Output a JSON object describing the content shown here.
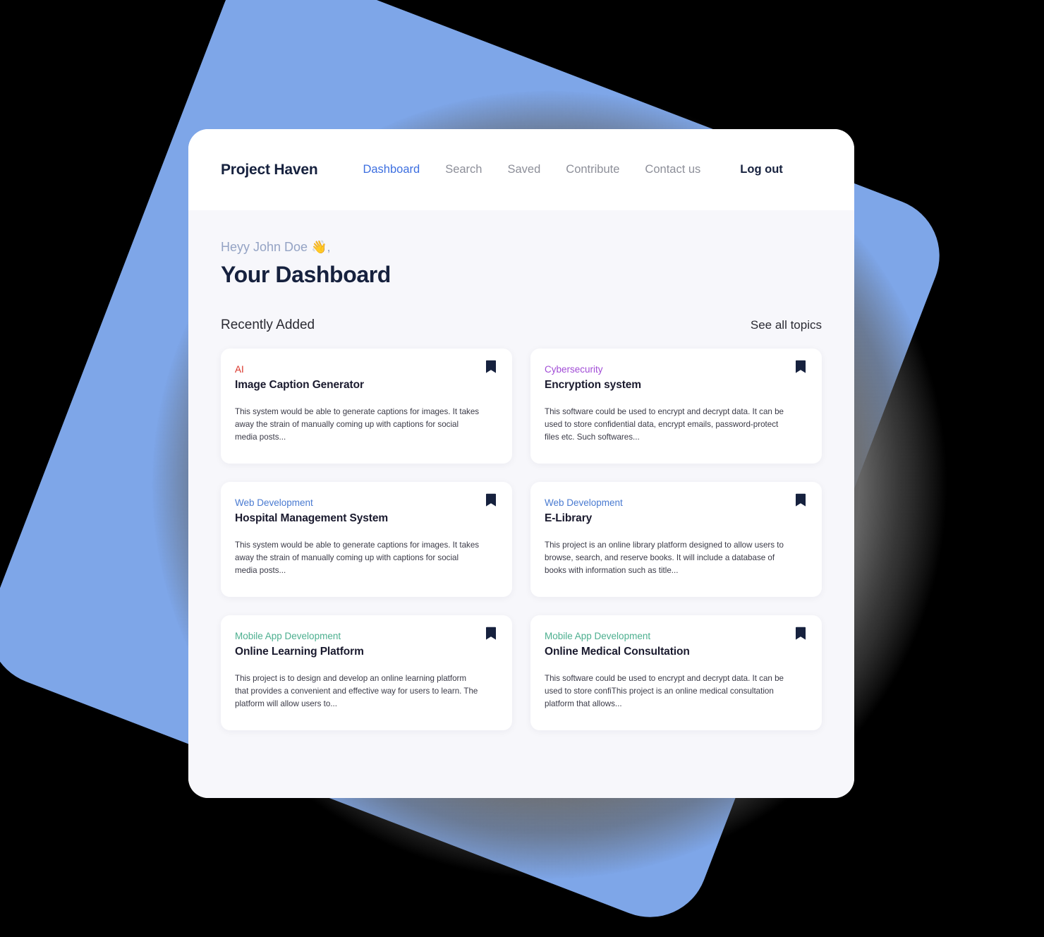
{
  "navbar": {
    "brand": "Project Haven",
    "links": [
      {
        "label": "Dashboard",
        "active": true
      },
      {
        "label": "Search",
        "active": false
      },
      {
        "label": "Saved",
        "active": false
      },
      {
        "label": "Contribute",
        "active": false
      },
      {
        "label": "Contact us",
        "active": false
      }
    ],
    "logout_label": "Log out"
  },
  "header": {
    "greeting": "Heyy John Doe 👋,",
    "title": "Your Dashboard"
  },
  "section": {
    "title": "Recently Added",
    "see_all_label": "See all topics"
  },
  "topic_colors": {
    "AI": "#D93025",
    "Cybersecurity": "#A14CD6",
    "Web Development": "#4A7BD1",
    "Mobile App Development": "#4CAF8F"
  },
  "icons": {
    "bookmark": "bookmark-icon",
    "bookmark_color": "#16213E"
  },
  "cards": [
    {
      "topic": "AI",
      "topic_color": "#D93025",
      "title": "Image Caption Generator",
      "description": "This system would be able to generate captions for images. It takes away the strain of manually coming up with captions for social media posts...",
      "bookmark": "bookmark-icon"
    },
    {
      "topic": "Cybersecurity",
      "topic_color": "#A14CD6",
      "title": "Encryption system",
      "description": "This software could be used to encrypt and decrypt data. It can be used to store confidential data, encrypt emails, password-protect files etc. Such softwares...",
      "bookmark": "bookmark-icon"
    },
    {
      "topic": "Web Development",
      "topic_color": "#4A7BD1",
      "title": "Hospital Management System",
      "description": "This system would be able to generate captions for images. It takes away the strain of manually coming up with captions for social media posts...",
      "bookmark": "bookmark-icon"
    },
    {
      "topic": "Web Development",
      "topic_color": "#4A7BD1",
      "title": "E-Library",
      "description": "This project is an online library platform designed to allow users to browse, search, and reserve books. It will include a database of books with information such as title...",
      "bookmark": "bookmark-icon"
    },
    {
      "topic": "Mobile App Development",
      "topic_color": "#4CAF8F",
      "title": "Online Learning Platform",
      "description": " This project is to design and develop an online learning platform that provides a convenient and effective way for users to learn. The platform will allow users to...",
      "bookmark": "bookmark-icon"
    },
    {
      "topic": "Mobile App Development",
      "topic_color": "#4CAF8F",
      "title": "Online Medical Consultation",
      "description": "This software could be used to encrypt and decrypt data. It can be used to store confiThis project is an online medical consultation platform that allows...",
      "bookmark": "bookmark-icon"
    }
  ],
  "decor": {
    "blue_shape_color": "#7EA6E8",
    "backdrop_color": "#000000"
  }
}
